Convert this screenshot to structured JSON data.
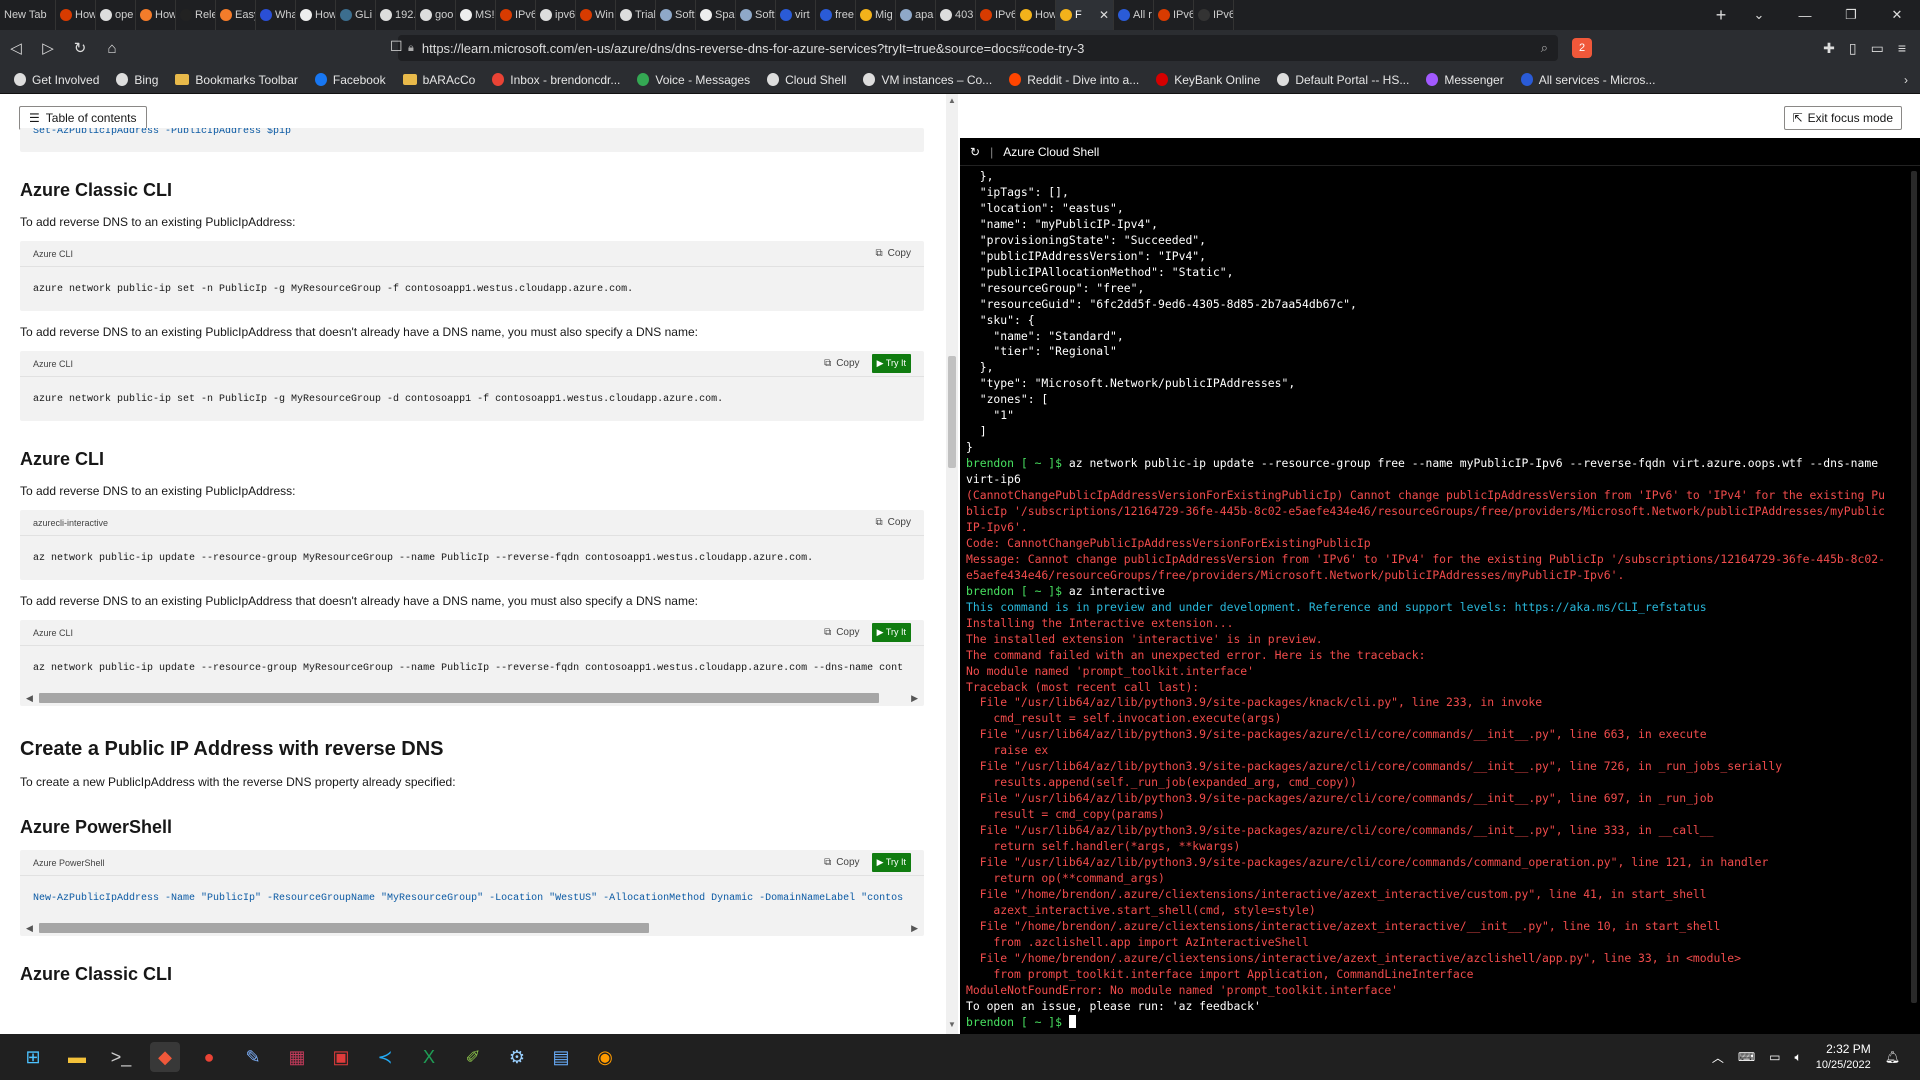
{
  "browser": {
    "tabs": [
      {
        "title": "New Tab",
        "color": "#444444"
      },
      {
        "title": "How",
        "color": "#d83b01"
      },
      {
        "title": "ope",
        "color": "#dddddd"
      },
      {
        "title": "How",
        "color": "#f47c2a"
      },
      {
        "title": "Rele",
        "color": "#222222"
      },
      {
        "title": "Easy",
        "color": "#f47c2a"
      },
      {
        "title": "Wha",
        "color": "#2a4fd6"
      },
      {
        "title": "How",
        "color": "#eeeeee"
      },
      {
        "title": "GLi",
        "color": "#3c6e8f"
      },
      {
        "title": "192.",
        "color": "#dddddd"
      },
      {
        "title": "goo",
        "color": "#dddddd"
      },
      {
        "title": "MS!",
        "color": "#eeeeee"
      },
      {
        "title": "IPv6",
        "color": "#d83b01"
      },
      {
        "title": "ipv6",
        "color": "#dddddd"
      },
      {
        "title": "Win",
        "color": "#d83b01"
      },
      {
        "title": "Trial",
        "color": "#dddddd"
      },
      {
        "title": "Soft",
        "color": "#8fa8c8"
      },
      {
        "title": "Spa",
        "color": "#eeeeee"
      },
      {
        "title": "Soft",
        "color": "#8fa8c8"
      },
      {
        "title": "virt",
        "color": "#2a5bd7"
      },
      {
        "title": "free",
        "color": "#2a5bd7"
      },
      {
        "title": "Mig",
        "color": "#f3b21b"
      },
      {
        "title": "apa",
        "color": "#8fa8c8"
      },
      {
        "title": "403",
        "color": "#dddddd"
      },
      {
        "title": "IPv6",
        "color": "#d83b01"
      },
      {
        "title": "How",
        "color": "#f3b21b"
      },
      {
        "title": "F",
        "color": "#f3b21b",
        "active": true
      },
      {
        "title": "All r",
        "color": "#2a5bd7"
      },
      {
        "title": "IPv6",
        "color": "#d83b01"
      },
      {
        "title": "IPv6",
        "color": "#333333"
      }
    ],
    "url": "https://learn.microsoft.com/en-us/azure/dns/dns-reverse-dns-for-azure-services?tryIt=true&source=docs#code-try-3",
    "brave_badge": "2",
    "bookmarks": [
      {
        "label": "Get Involved",
        "color": "#dddddd"
      },
      {
        "label": "Bing",
        "color": "#dddddd"
      },
      {
        "label": "Bookmarks Toolbar",
        "folder": true
      },
      {
        "label": "Facebook",
        "color": "#1877f2"
      },
      {
        "label": "bARAcCo",
        "folder": true
      },
      {
        "label": "Inbox - brendoncdr...",
        "color": "#ea4335"
      },
      {
        "label": "Voice - Messages",
        "color": "#34a853"
      },
      {
        "label": "Cloud Shell",
        "color": "#dddddd"
      },
      {
        "label": "VM instances – Co...",
        "color": "#dddddd"
      },
      {
        "label": "Reddit - Dive into a...",
        "color": "#ff4500"
      },
      {
        "label": "KeyBank Online",
        "color": "#d60000"
      },
      {
        "label": "Default Portal -- HS...",
        "color": "#dddddd"
      },
      {
        "label": "Messenger",
        "color": "#a259ff"
      },
      {
        "label": "All services - Micros...",
        "color": "#2a5bd7"
      }
    ]
  },
  "doc": {
    "toc_label": "Table of contents",
    "cut_code": "Set-AzPublicIpAddress -PublicIpAddress $pip",
    "sections": {
      "classic_cli_heading": "Azure Classic CLI",
      "classic_para1": "To add reverse DNS to an existing PublicIpAddress:",
      "classic_code1_lang": "Azure CLI",
      "classic_code1": "azure network public-ip set -n PublicIp -g MyResourceGroup -f contosoapp1.westus.cloudapp.azure.com.",
      "classic_para2": "To add reverse DNS to an existing PublicIpAddress that doesn't already have a DNS name, you must also specify a DNS name:",
      "classic_code2_lang": "Azure CLI",
      "classic_code2": "azure network public-ip set -n PublicIp -g MyResourceGroup -d contosoapp1 -f contosoapp1.westus.cloudapp.azure.com.",
      "azure_cli_heading": "Azure CLI",
      "cli_para1": "To add reverse DNS to an existing PublicIpAddress:",
      "cli_code1_lang": "azurecli-interactive",
      "cli_code1": "az network public-ip update --resource-group MyResourceGroup --name PublicIp --reverse-fqdn contosoapp1.westus.cloudapp.azure.com.",
      "cli_para2": "To add reverse DNS to an existing PublicIpAddress that doesn't already have a DNS name, you must also specify a DNS name:",
      "cli_code2_lang": "Azure CLI",
      "cli_code2": "az network public-ip update --resource-group MyResourceGroup --name PublicIp --reverse-fqdn contosoapp1.westus.cloudapp.azure.com --dns-name cont",
      "create_heading": "Create a Public IP Address with reverse DNS",
      "create_para": "To create a new PublicIpAddress with the reverse DNS property already specified:",
      "ps_heading": "Azure PowerShell",
      "ps_code_lang": "Azure PowerShell",
      "ps_code": "New-AzPublicIpAddress -Name \"PublicIp\" -ResourceGroupName \"MyResourceGroup\" -Location \"WestUS\" -AllocationMethod Dynamic -DomainNameLabel \"contos",
      "classic_cli_heading2": "Azure Classic CLI"
    },
    "copy_label": "Copy",
    "tryit_label": "Try It"
  },
  "shell": {
    "title": "Azure Cloud Shell",
    "exit_focus_label": "Exit focus mode",
    "lines": [
      {
        "t": "  },",
        "c": ""
      },
      {
        "t": "  \"ipTags\": [],",
        "c": ""
      },
      {
        "t": "  \"location\": \"eastus\",",
        "c": ""
      },
      {
        "t": "  \"name\": \"myPublicIP-Ipv4\",",
        "c": ""
      },
      {
        "t": "  \"provisioningState\": \"Succeeded\",",
        "c": ""
      },
      {
        "t": "  \"publicIPAddressVersion\": \"IPv4\",",
        "c": ""
      },
      {
        "t": "  \"publicIPAllocationMethod\": \"Static\",",
        "c": ""
      },
      {
        "t": "  \"resourceGroup\": \"free\",",
        "c": ""
      },
      {
        "t": "  \"resourceGuid\": \"6fc2dd5f-9ed6-4305-8d85-2b7aa54db67c\",",
        "c": ""
      },
      {
        "t": "  \"sku\": {",
        "c": ""
      },
      {
        "t": "    \"name\": \"Standard\",",
        "c": ""
      },
      {
        "t": "    \"tier\": \"Regional\"",
        "c": ""
      },
      {
        "t": "  },",
        "c": ""
      },
      {
        "t": "  \"type\": \"Microsoft.Network/publicIPAddresses\",",
        "c": ""
      },
      {
        "t": "  \"zones\": [",
        "c": ""
      },
      {
        "t": "    \"1\"",
        "c": ""
      },
      {
        "t": "  ]",
        "c": ""
      },
      {
        "t": "}",
        "c": ""
      },
      {
        "p": "brendon [ ~ ]$ ",
        "t": "az network public-ip update --resource-group free --name myPublicIP-Ipv6 --reverse-fqdn virt.azure.oops.wtf --dns-name",
        "c": ""
      },
      {
        "t": "virt-ip6",
        "c": ""
      },
      {
        "t": "(CannotChangePublicIpAddressVersionForExistingPublicIp) Cannot change publicIpAddressVersion from 'IPv6' to 'IPv4' for the existing Pu",
        "c": "r"
      },
      {
        "t": "blicIp '/subscriptions/12164729-36fe-445b-8c02-e5aefe434e46/resourceGroups/free/providers/Microsoft.Network/publicIPAddresses/myPublic",
        "c": "r"
      },
      {
        "t": "IP-Ipv6'.",
        "c": "r"
      },
      {
        "t": "Code: CannotChangePublicIpAddressVersionForExistingPublicIp",
        "c": "r"
      },
      {
        "t": "Message: Cannot change publicIpAddressVersion from 'IPv6' to 'IPv4' for the existing PublicIp '/subscriptions/12164729-36fe-445b-8c02-",
        "c": "r"
      },
      {
        "t": "e5aefe434e46/resourceGroups/free/providers/Microsoft.Network/publicIPAddresses/myPublicIP-Ipv6'.",
        "c": "r"
      },
      {
        "p": "brendon [ ~ ]$ ",
        "t": "az interactive",
        "c": ""
      },
      {
        "t": "This command is in preview and under development. Reference and support levels: https://aka.ms/CLI_refstatus",
        "c": "c"
      },
      {
        "t": "Installing the Interactive extension...",
        "c": "r"
      },
      {
        "t": "The installed extension 'interactive' is in preview.",
        "c": "r"
      },
      {
        "t": "The command failed with an unexpected error. Here is the traceback:",
        "c": "r"
      },
      {
        "t": "No module named 'prompt_toolkit.interface'",
        "c": "r"
      },
      {
        "t": "Traceback (most recent call last):",
        "c": "r"
      },
      {
        "t": "  File \"/usr/lib64/az/lib/python3.9/site-packages/knack/cli.py\", line 233, in invoke",
        "c": "r"
      },
      {
        "t": "    cmd_result = self.invocation.execute(args)",
        "c": "r"
      },
      {
        "t": "  File \"/usr/lib64/az/lib/python3.9/site-packages/azure/cli/core/commands/__init__.py\", line 663, in execute",
        "c": "r"
      },
      {
        "t": "    raise ex",
        "c": "r"
      },
      {
        "t": "  File \"/usr/lib64/az/lib/python3.9/site-packages/azure/cli/core/commands/__init__.py\", line 726, in _run_jobs_serially",
        "c": "r"
      },
      {
        "t": "    results.append(self._run_job(expanded_arg, cmd_copy))",
        "c": "r"
      },
      {
        "t": "  File \"/usr/lib64/az/lib/python3.9/site-packages/azure/cli/core/commands/__init__.py\", line 697, in _run_job",
        "c": "r"
      },
      {
        "t": "    result = cmd_copy(params)",
        "c": "r"
      },
      {
        "t": "  File \"/usr/lib64/az/lib/python3.9/site-packages/azure/cli/core/commands/__init__.py\", line 333, in __call__",
        "c": "r"
      },
      {
        "t": "    return self.handler(*args, **kwargs)",
        "c": "r"
      },
      {
        "t": "  File \"/usr/lib64/az/lib/python3.9/site-packages/azure/cli/core/commands/command_operation.py\", line 121, in handler",
        "c": "r"
      },
      {
        "t": "    return op(**command_args)",
        "c": "r"
      },
      {
        "t": "  File \"/home/brendon/.azure/cliextensions/interactive/azext_interactive/custom.py\", line 41, in start_shell",
        "c": "r"
      },
      {
        "t": "    azext_interactive.start_shell(cmd, style=style)",
        "c": "r"
      },
      {
        "t": "  File \"/home/brendon/.azure/cliextensions/interactive/azext_interactive/__init__.py\", line 10, in start_shell",
        "c": "r"
      },
      {
        "t": "    from .azclishell.app import AzInteractiveShell",
        "c": "r"
      },
      {
        "t": "  File \"/home/brendon/.azure/cliextensions/interactive/azext_interactive/azclishell/app.py\", line 33, in <module>",
        "c": "r"
      },
      {
        "t": "    from prompt_toolkit.interface import Application, CommandLineInterface",
        "c": "r"
      },
      {
        "t": "ModuleNotFoundError: No module named 'prompt_toolkit.interface'",
        "c": "r"
      },
      {
        "t": "To open an issue, please run: 'az feedback'",
        "c": ""
      },
      {
        "p": "brendon [ ~ ]$ ",
        "t": "",
        "c": "",
        "cursor": true
      }
    ]
  },
  "taskbar": {
    "time": "2:32 PM",
    "date": "10/25/2022",
    "apps": [
      {
        "name": "start",
        "glyph": "⊞",
        "color": "#4cc2ff"
      },
      {
        "name": "file-explorer",
        "glyph": "▬",
        "color": "#f3c13a"
      },
      {
        "name": "terminal",
        "glyph": ">_",
        "color": "#cccccc"
      },
      {
        "name": "brave",
        "glyph": "◆",
        "color": "#f0583a",
        "active": true
      },
      {
        "name": "chrome",
        "glyph": "●",
        "color": "#ea4335"
      },
      {
        "name": "paint",
        "glyph": "✎",
        "color": "#7fb3ff"
      },
      {
        "name": "winrar",
        "glyph": "▦",
        "color": "#c23a5a"
      },
      {
        "name": "acrobat",
        "glyph": "▣",
        "color": "#e03b3b"
      },
      {
        "name": "vscode",
        "glyph": "≺",
        "color": "#23a9f2"
      },
      {
        "name": "excel",
        "glyph": "X",
        "color": "#1f9d55"
      },
      {
        "name": "notepad-plus",
        "glyph": "✐",
        "color": "#8bc34a"
      },
      {
        "name": "settings",
        "glyph": "⚙",
        "color": "#9ad0ff"
      },
      {
        "name": "calculator",
        "glyph": "▤",
        "color": "#6ab0ff"
      },
      {
        "name": "app-orange",
        "glyph": "◉",
        "color": "#ff9b00"
      }
    ]
  }
}
